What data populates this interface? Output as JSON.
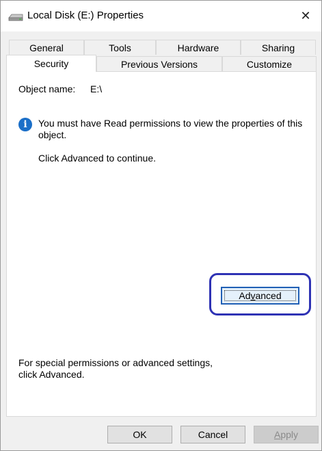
{
  "window": {
    "title": "Local Disk (E:) Properties",
    "close_glyph": "✕",
    "icon": "drive-icon"
  },
  "tabs": {
    "row1": [
      "General",
      "Tools",
      "Hardware",
      "Sharing"
    ],
    "row2": [
      "Security",
      "Previous Versions",
      "Customize"
    ],
    "active": "Security"
  },
  "security": {
    "object_name_label": "Object name:",
    "object_name_value": "E:\\",
    "info_icon": "info-icon",
    "info_glyph": "i",
    "message_line1": "You must have Read permissions to view the properties of this",
    "message_line2": "object.",
    "continue_text": "Click Advanced to continue.",
    "special_line1": "For special permissions or advanced settings,",
    "special_line2": "click Advanced.",
    "advanced_pre": "Ad",
    "advanced_accel": "v",
    "advanced_post": "anced"
  },
  "footer": {
    "ok_label": "OK",
    "cancel_label": "Cancel",
    "apply_accel": "A",
    "apply_post": "pply"
  },
  "colors": {
    "accent": "#1b6fc8",
    "highlight_ring": "#2e32b4",
    "disabled_text": "#8a8a8a"
  }
}
